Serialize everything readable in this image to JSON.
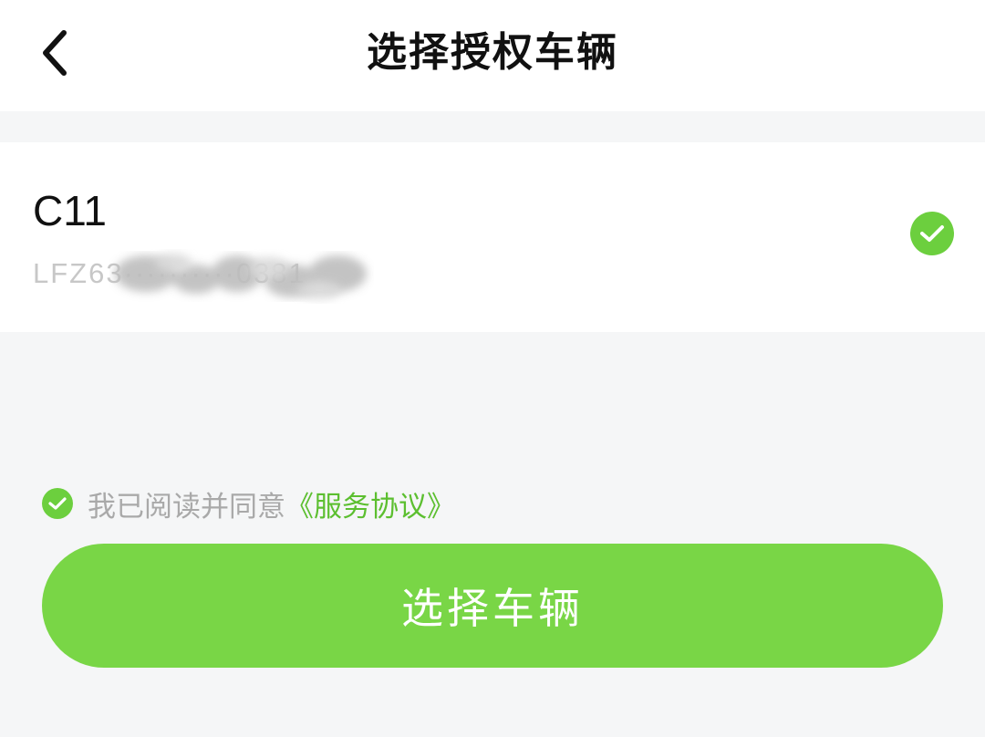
{
  "header": {
    "title": "选择授权车辆",
    "back_icon": "chevron-left-icon"
  },
  "vehicle": {
    "name": "C11",
    "vin": "LFZ63··········0381",
    "selected": true,
    "check_icon": "check-circle-icon"
  },
  "agreement": {
    "prefix": "我已阅读并同意",
    "link": "《服务协议》",
    "checked": true,
    "check_icon": "check-circle-icon"
  },
  "action": {
    "button_label": "选择车辆"
  },
  "colors": {
    "accent": "#79d646",
    "check": "#6ccf3e",
    "link": "#5cbf30",
    "background": "#f5f6f7"
  }
}
